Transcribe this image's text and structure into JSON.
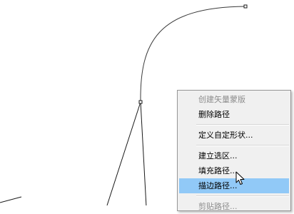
{
  "canvas": {
    "path_color": "#3a3a3a"
  },
  "context_menu": {
    "items": [
      {
        "label": "创建矢量蒙版",
        "disabled": true
      },
      {
        "label": "删除路径"
      },
      {
        "label": "定义自定形状..."
      },
      {
        "label": "建立选区..."
      },
      {
        "label": "填充路径..."
      },
      {
        "label": "描边路径...",
        "highlighted": true
      },
      {
        "label": "剪贴路径...",
        "disabled": true
      }
    ],
    "highlight_color": "#91c9f7"
  },
  "cursor": {
    "icon": "arrow-cursor-icon"
  }
}
